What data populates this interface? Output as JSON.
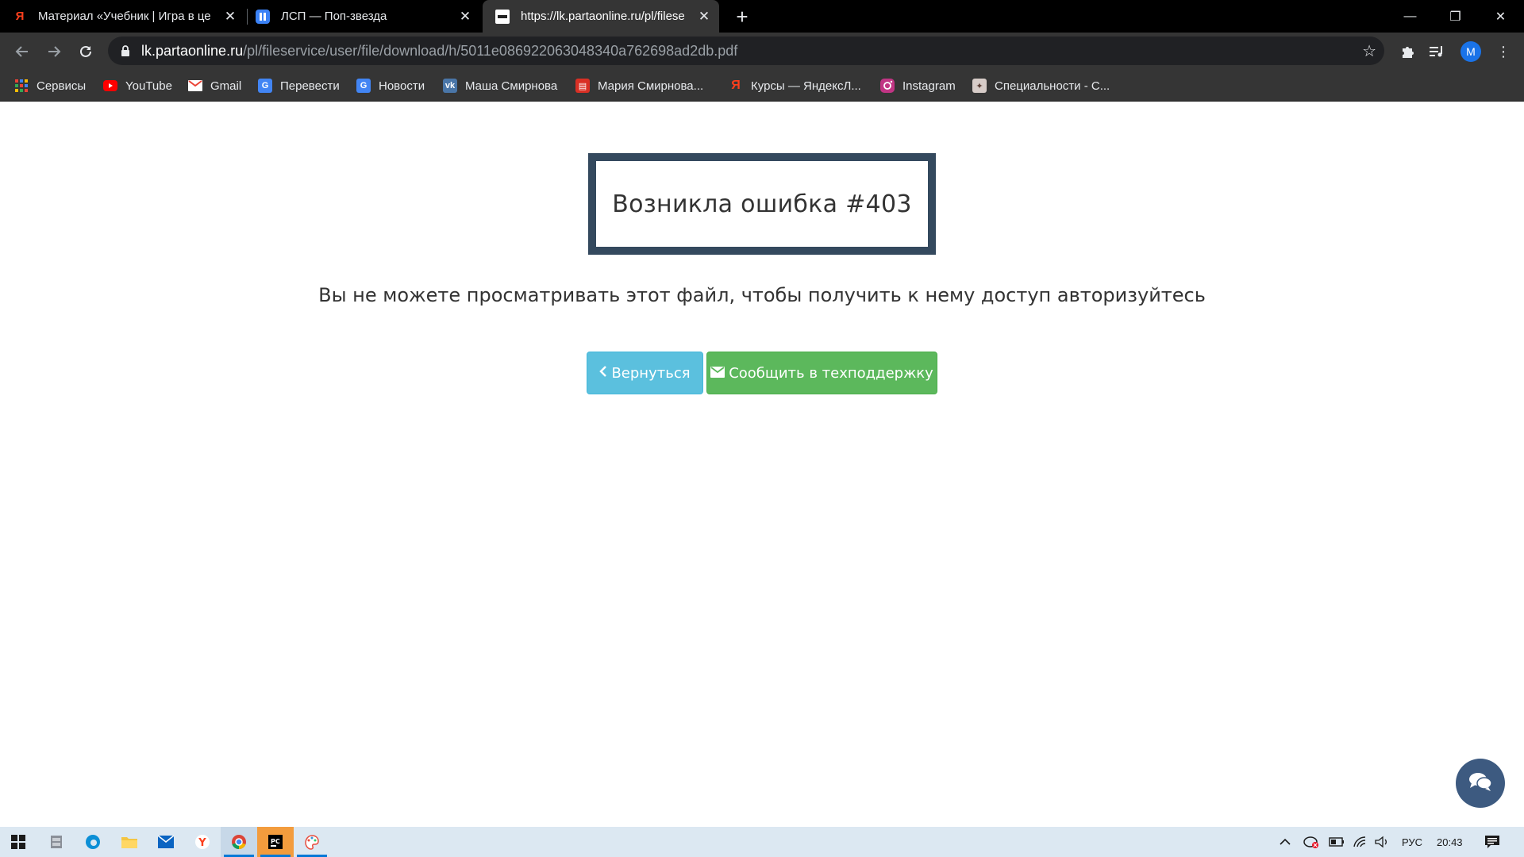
{
  "tabs": [
    {
      "title": "Материал «Учебник | Игра в це",
      "favicon": "yandex-icon",
      "active": false
    },
    {
      "title": "ЛСП — Поп-звезда",
      "favicon": "pause-icon",
      "active": false
    },
    {
      "title": "https://lk.partaonline.ru/pl/filese",
      "favicon": "parta-icon",
      "active": true
    }
  ],
  "window_controls": {
    "minimize": "—",
    "restore": "❐",
    "close": "✕"
  },
  "address": {
    "host": "lk.partaonline.ru",
    "path": "/pl/fileservice/user/file/download/h/5011e086922063048340a762698ad2db.pdf"
  },
  "profile": {
    "initial": "M"
  },
  "bookmarks": [
    {
      "label": "Сервисы",
      "icon": "apps-grid-icon"
    },
    {
      "label": "YouTube",
      "icon": "youtube-icon"
    },
    {
      "label": "Gmail",
      "icon": "gmail-icon"
    },
    {
      "label": "Перевести",
      "icon": "translate-icon"
    },
    {
      "label": "Новости",
      "icon": "news-icon"
    },
    {
      "label": "Маша Смирнова",
      "icon": "vk-icon"
    },
    {
      "label": "Мария Смирнова...",
      "icon": "red-doc-icon"
    },
    {
      "label": "Курсы — ЯндексЛ...",
      "icon": "yandex-icon"
    },
    {
      "label": "Instagram",
      "icon": "instagram-icon"
    },
    {
      "label": "Специальности - С...",
      "icon": "emblem-icon"
    }
  ],
  "page": {
    "error_title": "Возникла ошибка #403",
    "error_message": "Вы не можете просматривать этот файл, чтобы получить к нему доступ авторизуйтесь",
    "back_button": "Вернуться",
    "support_button": "Сообщить в техподдержку"
  },
  "colors": {
    "error_border": "#34495e",
    "back_button": "#5bc0de",
    "support_button": "#5cb85c",
    "chat_button": "#3d5a80"
  },
  "taskbar": {
    "apps": [
      "windows-start-icon",
      "file-cabinet-icon",
      "edge-icon",
      "file-explorer-icon",
      "mail-icon",
      "yandex-browser-icon",
      "chrome-icon",
      "pycharm-icon",
      "paint-icon"
    ],
    "language": "РУС",
    "time": "20:43"
  }
}
